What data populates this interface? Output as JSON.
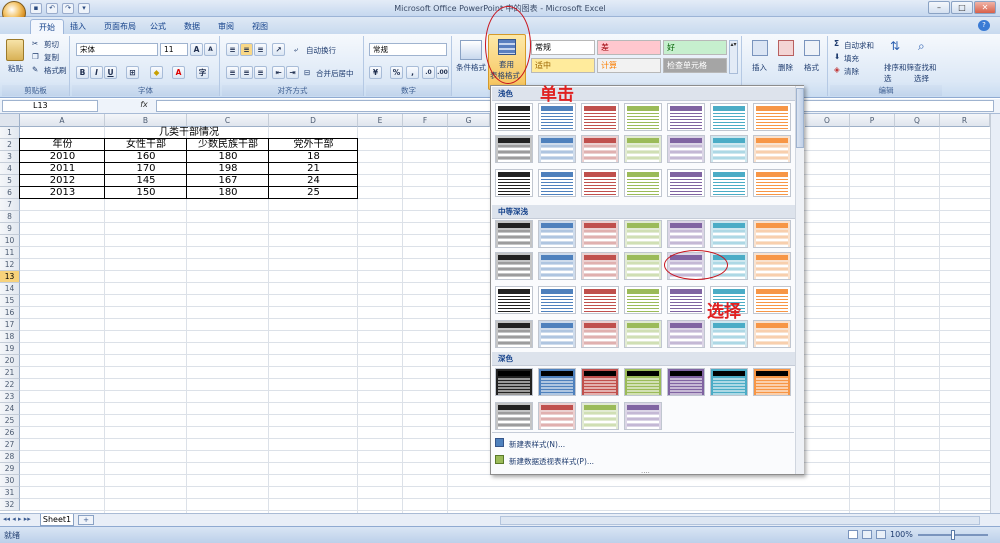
{
  "window": {
    "title": "Microsoft Office PowerPoint 中的图表 - Microsoft Excel"
  },
  "tabs": [
    "开始",
    "插入",
    "页面布局",
    "公式",
    "数据",
    "审阅",
    "视图"
  ],
  "ribbon": {
    "clipboard": {
      "paste": "粘贴",
      "cut": "剪切",
      "copy": "复制",
      "format_painter": "格式刷",
      "label": "剪贴板"
    },
    "font": {
      "name": "宋体",
      "size": "11",
      "grow": "A",
      "shrink": "A",
      "label": "字体"
    },
    "alignment": {
      "wrap": "自动换行",
      "merge": "合并后居中",
      "label": "对齐方式"
    },
    "number": {
      "format": "常规",
      "percent": "%",
      "comma": ",",
      "label": "数字"
    },
    "styles": {
      "conditional": "条件格式",
      "table_format_line1": "套用",
      "table_format_line2": "表格格式",
      "cells": [
        {
          "text": "常规",
          "bg": "#ffffff",
          "color": "#000000"
        },
        {
          "text": "差",
          "bg": "#ffc7ce",
          "color": "#9c0006"
        },
        {
          "text": "好",
          "bg": "#c6efce",
          "color": "#006100"
        },
        {
          "text": "适中",
          "bg": "#ffeb9c",
          "color": "#9c6500"
        },
        {
          "text": "计算",
          "bg": "#f2f2f2",
          "color": "#fa7d00"
        },
        {
          "text": "检查单元格",
          "bg": "#a5a5a5",
          "color": "#ffffff"
        }
      ]
    },
    "cells_grp": {
      "insert": "插入",
      "delete": "删除",
      "format": "格式"
    },
    "editing": {
      "autosum": "自动求和",
      "fill": "填充",
      "clear": "清除",
      "sort": "排序和筛选",
      "find": "查找和选择",
      "label": "编辑"
    }
  },
  "formula_bar": {
    "name_box": "L13",
    "fx": "fx"
  },
  "columns": [
    "A",
    "B",
    "C",
    "D",
    "E",
    "F",
    "G",
    "O",
    "P",
    "Q",
    "R"
  ],
  "rows": [
    "1",
    "2",
    "3",
    "4",
    "5",
    "6",
    "7",
    "8",
    "9",
    "10",
    "11",
    "12",
    "13",
    "14",
    "15",
    "16",
    "17",
    "18",
    "19",
    "20",
    "21",
    "22",
    "23",
    "24",
    "25",
    "26",
    "27",
    "28",
    "29",
    "30",
    "31",
    "32"
  ],
  "selected_row": "13",
  "table": {
    "title": "几类干部情况",
    "headers": [
      "年份",
      "女性干部",
      "少数民族干部",
      "党外干部"
    ],
    "rows": [
      [
        "2010",
        "160",
        "180",
        "18"
      ],
      [
        "2011",
        "170",
        "198",
        "21"
      ],
      [
        "2012",
        "145",
        "167",
        "24"
      ],
      [
        "2013",
        "150",
        "180",
        "25"
      ]
    ]
  },
  "gallery": {
    "sections": [
      "浅色",
      "中等深浅",
      "深色"
    ],
    "new_table_style": "新建表样式(N)...",
    "new_pivot_style": "新建数据透视表样式(P)...",
    "palette": [
      "#222222",
      "#4f81bd",
      "#c0504d",
      "#9bbb59",
      "#8064a2",
      "#4bacc6",
      "#f79646"
    ]
  },
  "annotations": {
    "click": "单击",
    "select": "选择"
  },
  "sheet_tabs": {
    "sheet1": "Sheet1"
  },
  "status": {
    "ready": "就绪",
    "zoom": "100%"
  }
}
